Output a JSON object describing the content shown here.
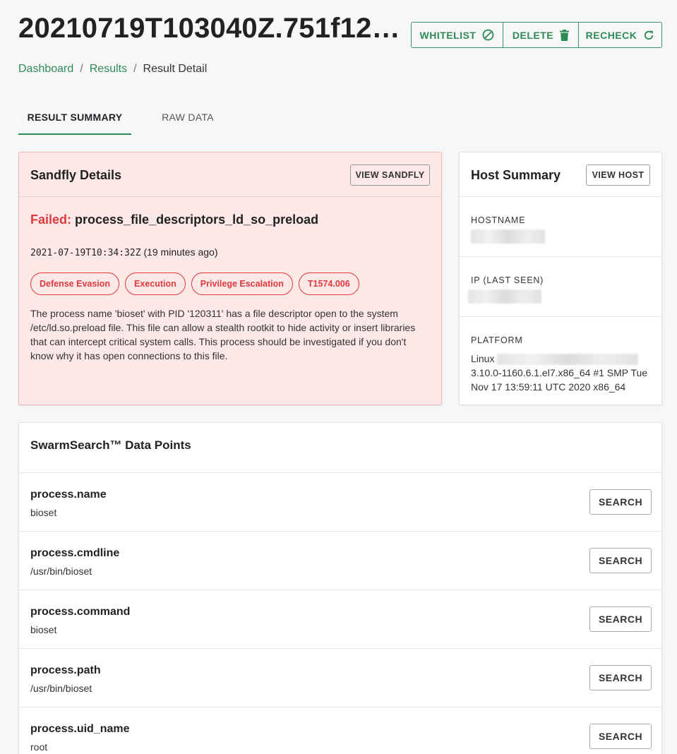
{
  "header": {
    "title": "20210719T103040Z.751f12…",
    "actions": {
      "whitelist": "WHITELIST",
      "delete": "DELETE",
      "recheck": "RECHECK"
    }
  },
  "breadcrumb": {
    "dashboard": "Dashboard",
    "results": "Results",
    "current": "Result Detail",
    "separator": "/"
  },
  "tabs": {
    "summary": "RESULT SUMMARY",
    "raw": "RAW DATA"
  },
  "sandfly": {
    "title": "Sandfly Details",
    "view_button": "VIEW SANDFLY",
    "status": "Failed:",
    "name": "process_file_descriptors_ld_so_preload",
    "timestamp": "2021-07-19T10:34:32Z",
    "relative": "(19 minutes ago)",
    "tags": [
      "Defense Evasion",
      "Execution",
      "Privilege Escalation",
      "T1574.006"
    ],
    "description": "The process name 'bioset' with PID '120311' has a file descriptor open to the system /etc/ld.so.preload file. This file can allow a stealth rootkit to hide activity or insert libraries that can intercept critical system calls. This process should be investigated if you don't know why it has open connections to this file."
  },
  "host": {
    "title": "Host Summary",
    "view_button": "VIEW HOST",
    "hostname_label": "HOSTNAME",
    "ip_label": "IP (LAST SEEN)",
    "platform_label": "PLATFORM",
    "platform_prefix": "Linux",
    "platform_rest": "3.10.0-1160.6.1.el7.x86_64 #1 SMP Tue Nov 17 13:59:11 UTC 2020 x86_64"
  },
  "swarm": {
    "title": "SwarmSearch™ Data Points",
    "search_label": "SEARCH",
    "rows": [
      {
        "key": "process.name",
        "value": "bioset"
      },
      {
        "key": "process.cmdline",
        "value": "/usr/bin/bioset"
      },
      {
        "key": "process.command",
        "value": "bioset"
      },
      {
        "key": "process.path",
        "value": "/usr/bin/bioset"
      },
      {
        "key": "process.uid_name",
        "value": "root"
      }
    ]
  },
  "colors": {
    "accent": "#2e8b57",
    "danger": "#e0393e",
    "alert_bg": "#fde8e8"
  }
}
